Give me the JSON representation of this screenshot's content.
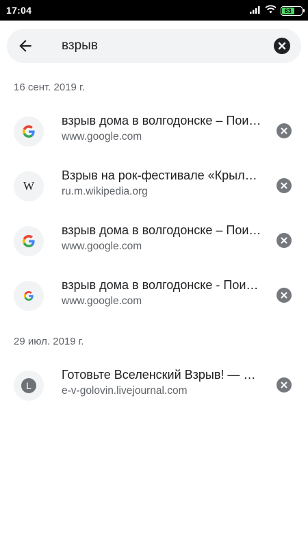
{
  "status_bar": {
    "time": "17:04",
    "battery": "63",
    "battery_color": "#4cd964"
  },
  "search": {
    "query": "взрыв",
    "back_icon": "arrow-left-icon",
    "clear_icon": "close-circle-icon"
  },
  "groups": [
    {
      "date": "16 сент. 2019 г.",
      "items": [
        {
          "title": "взрыв дома в волгодонске – Поиск в Google",
          "url": "www.google.com",
          "icon": "google-icon"
        },
        {
          "title": "Взрыв на рок-фестивале «Крылья»",
          "url": "ru.m.wikipedia.org",
          "icon": "wikipedia-icon"
        },
        {
          "title": "взрыв дома в волгодонске – Поиск в Google",
          "url": "www.google.com",
          "icon": "google-icon"
        },
        {
          "title": "взрыв дома в волгодонске - Поиск в Google",
          "url": "www.google.com",
          "icon": "google-icon"
        }
      ]
    },
    {
      "date": "29 июл. 2019 г.",
      "items": [
        {
          "title": "Готовьте Вселенский Взрыв! — Блог",
          "url": "e-v-golovin.livejournal.com",
          "icon": "letter-l-icon",
          "letter": "L"
        }
      ]
    }
  ],
  "colors": {
    "accent_text": "#202124",
    "secondary_text": "#5f6368",
    "search_bg": "#f1f3f4"
  }
}
